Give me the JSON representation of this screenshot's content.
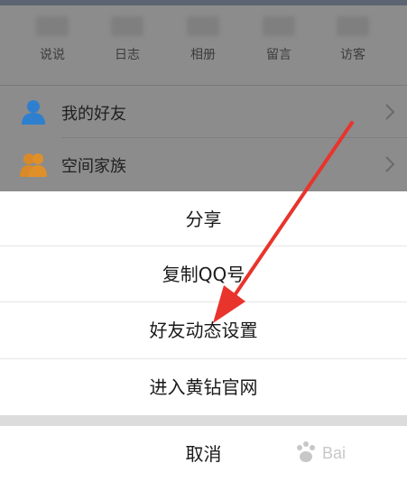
{
  "profile_tabs": [
    {
      "label": "说说"
    },
    {
      "label": "日志"
    },
    {
      "label": "相册"
    },
    {
      "label": "留言"
    },
    {
      "label": "访客"
    }
  ],
  "menu": {
    "friends": {
      "label": "我的好友",
      "icon": "person-icon"
    },
    "family": {
      "label": "空间家族",
      "icon": "group-icon"
    }
  },
  "action_sheet": {
    "share": "分享",
    "copy_qq": "复制QQ号",
    "friend_feed_settings": "好友动态设置",
    "yellow_diamond": "进入黄钻官网",
    "cancel": "取消"
  },
  "colors": {
    "overlay": "#8c8c8c",
    "icon_blue": "#2f7fcf",
    "icon_orange": "#e0902a",
    "arrow": "#e8342c"
  },
  "annotation": {
    "type": "arrow",
    "points_to": "friend_feed_settings"
  },
  "watermark": {
    "icon": "baidu-paw-icon",
    "text": "Bai"
  }
}
